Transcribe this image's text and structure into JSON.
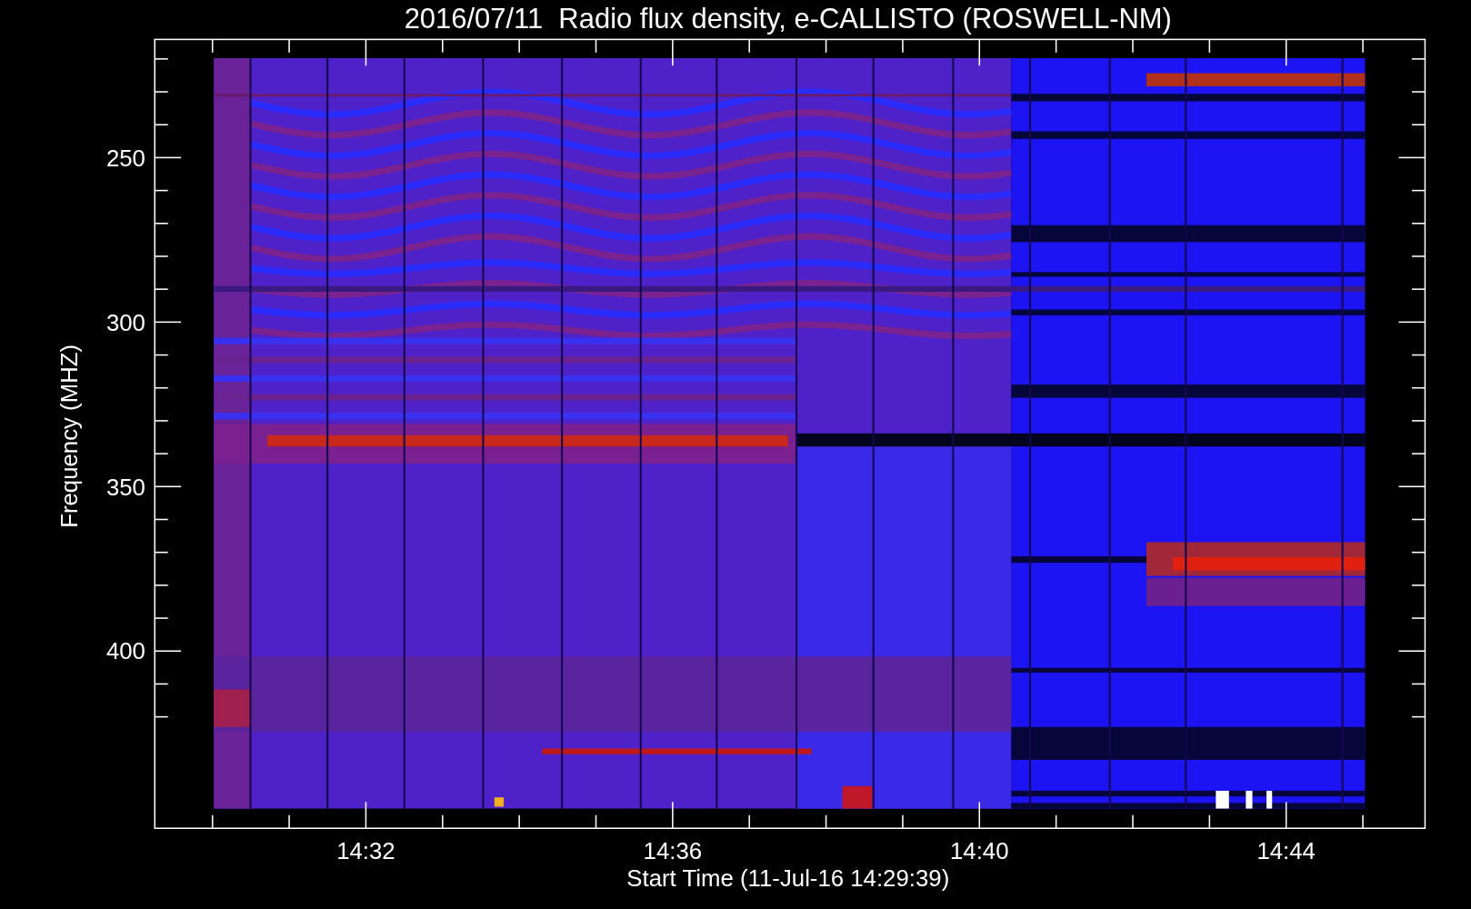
{
  "title": "2016/07/11  Radio flux density, e-CALLISTO (ROSWELL-NM)",
  "y_axis": {
    "label": "Frequency (MHZ)",
    "ticks": [
      "250",
      "300",
      "350",
      "400"
    ]
  },
  "x_axis": {
    "label": "Start Time (11-Jul-16 14:29:39)",
    "ticks": [
      "14:32",
      "14:36",
      "14:40",
      "14:44"
    ]
  }
}
